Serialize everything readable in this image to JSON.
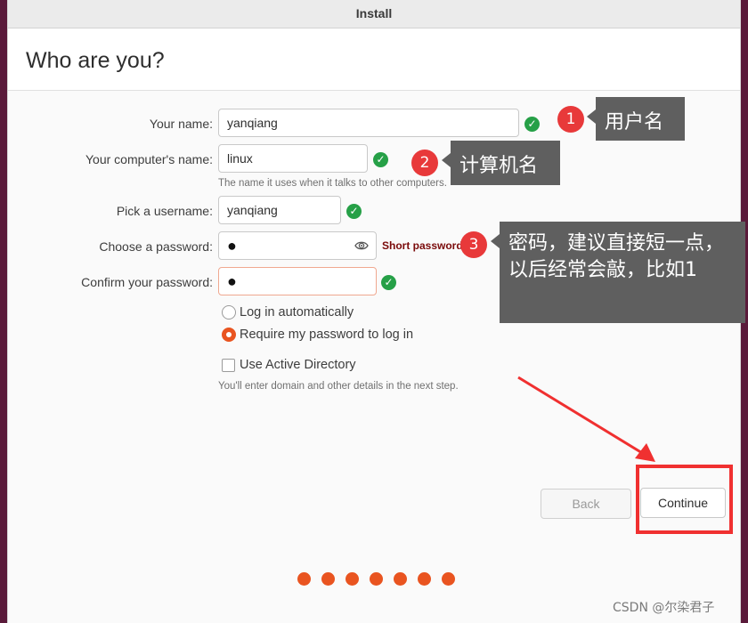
{
  "window": {
    "title": "Install"
  },
  "page": {
    "title": "Who are you?"
  },
  "form": {
    "your_name": {
      "label": "Your name:",
      "value": "yanqiang"
    },
    "computer_name": {
      "label": "Your computer's name:",
      "value": "linux",
      "hint": "The name it uses when it talks to other computers."
    },
    "username": {
      "label": "Pick a username:",
      "value": "yanqiang"
    },
    "password": {
      "label": "Choose a password:",
      "value": "●",
      "strength": "Short password"
    },
    "confirm_password": {
      "label": "Confirm your password:",
      "value": "●"
    },
    "check_mark": "✓"
  },
  "login_options": {
    "auto": {
      "label": "Log in automatically",
      "selected": false
    },
    "require": {
      "label": "Require my password to log in",
      "selected": true
    }
  },
  "active_directory": {
    "label": "Use Active Directory",
    "checked": false,
    "hint": "You'll enter domain and other details in the next step."
  },
  "buttons": {
    "back": "Back",
    "continue": "Continue"
  },
  "progress": {
    "steps": 7
  },
  "annotations": [
    {
      "number": "1",
      "text": "用户名"
    },
    {
      "number": "2",
      "text": "计算机名"
    },
    {
      "number": "3",
      "text": "密码，建议直接短一点，以后经常会敲，比如1"
    }
  ],
  "watermark": "CSDN @尔染君子",
  "colors": {
    "accent": "#e95420",
    "ok": "#26a047",
    "annotation_red": "#e8393a",
    "callout_bg": "#5f5f5f"
  }
}
